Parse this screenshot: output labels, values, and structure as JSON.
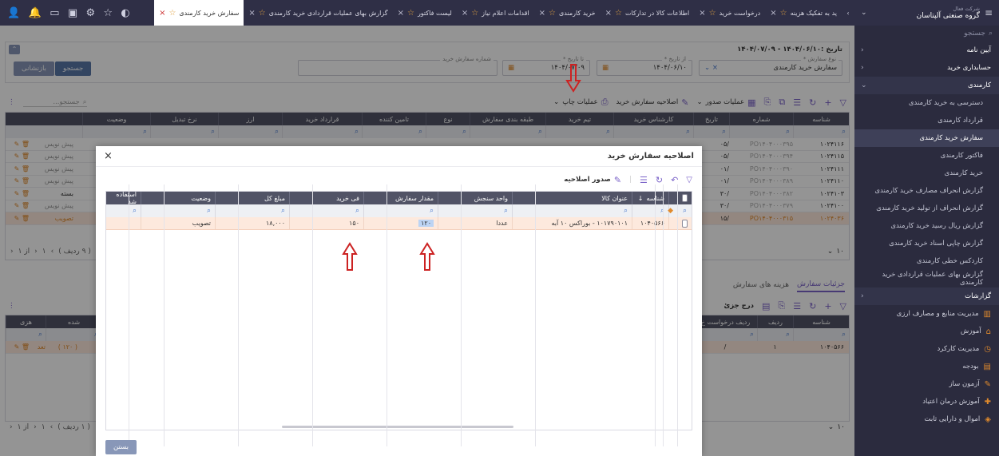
{
  "sidebar": {
    "company_sub": "شرکت فعال",
    "company": "گروه صنعتی آلپتاسان",
    "search_placeholder": "جستجو",
    "items": [
      {
        "label": "آیین نامه",
        "chev": "‹"
      },
      {
        "label": "حسابداری خرید",
        "chev": "‹"
      },
      {
        "label": "کارمندی",
        "chev": "⌄"
      }
    ],
    "subitems": [
      "دسترسی به خرید کارمندی",
      "قرارداد کارمندی",
      "سفارش خرید کارمندی",
      "فاکتور کارمندی",
      "خرید کارمندی",
      "گزارش انحراف مصارف خرید کارمندی",
      "گزارش انحراف از تولید خرید کارمندی",
      "گزارش ریال رسید خرید کارمندی",
      "گزارش چاپی اسناد خرید کارمندی",
      "کاردکس خطی کارمندی",
      "گزارش بهای عملیات قراردادی خرید کارمندی"
    ],
    "reports": "گزارشات",
    "modules": [
      "مدیریت منابع و مصارف ارزی",
      "آموزش",
      "مدیریت کارکرد",
      "بودجه",
      "آزمون ساز",
      "آموزش درمان اعتیاد",
      "اموال و دارایی ثابت"
    ]
  },
  "tabs": [
    "سفارش خرید کارمندی",
    "گزارش بهای عملیات قراردادی خرید کارمندی",
    "لیست فاکتور",
    "اقدامات اعلام نیاز",
    "خرید کارمندی",
    "اطلاعات کالا در تدارکات",
    "درخواست خرید",
    "ید به تفکیک هزینه"
  ],
  "filters": {
    "date_title": "تاریخ :۱۴۰۴/۰۶/۱۰ - ۱۴۰۴/۰۷/۰۹",
    "order_type_label": "نوع سفارش *",
    "order_type_value": "سفارش خرید کارمندی",
    "from_date_label": "از تاریخ *",
    "from_date_value": "۱۴۰۴/۰۶/۱۰",
    "to_date_label": "تا تاریخ *",
    "to_date_value": "۱۴۰۴/۰۷/۰۹",
    "order_no_label": "شماره سفارش خرید",
    "search_btn": "جستجو",
    "reset_btn": "بازنشانی"
  },
  "toolbar": {
    "issue_ops": "عملیات صدور",
    "amend_order": "اصلاحیه سفارش خرید",
    "print_ops": "عملیات چاپ",
    "search_placeholder": "جستجو..."
  },
  "grid": {
    "headers": [
      "شناسه",
      "شماره",
      "تاریخ",
      "کارشناس خرید",
      "تیم خرید",
      "طبقه بندی سفارش",
      "نوع",
      "تامین کننده",
      "قرارداد خرید",
      "ارز",
      "نرخ تبدیل",
      "وضعیت"
    ],
    "rows": [
      {
        "id": "۱۰۲۴۱۱۶",
        "num": "PO۱۴۰۴۰۰۰۳۹۵",
        "date": "/۰۵",
        "status": "پیش نویس"
      },
      {
        "id": "۱۰۲۴۱۱۵",
        "num": "PO۱۴۰۴۰۰۰۳۹۴",
        "date": "/۰۵",
        "status": "پیش نویس"
      },
      {
        "id": "۱۰۲۴۱۱۱",
        "num": "PO۱۴۰۴۰۰۰۳۹۰",
        "date": "/۰۱",
        "status": "پیش نویس"
      },
      {
        "id": "۱۰۲۴۱۱۰",
        "num": "PO۱۴۰۴۰۰۰۳۸۹",
        "date": "/۰۱",
        "status": "پیش نویس"
      },
      {
        "id": "۱۰۲۴۱۰۳",
        "num": "PO۱۴۰۴۰۰۰۳۸۲",
        "date": "/۳۰",
        "status": "بسته"
      },
      {
        "id": "۱۰۲۴۱۰۰",
        "num": "PO۱۴۰۴۰۰۰۳۷۹",
        "date": "/۳۰",
        "status": "پیش نویس"
      },
      {
        "id": "۱۰۲۴۰۳۶",
        "num": "PO۱۴۰۴۰۰۰۳۱۵",
        "date": "/۱۵",
        "status": "تصویب"
      }
    ],
    "pager": "( ۹ ردیف )",
    "page_of": "از ۱",
    "page_num": "۱",
    "page_size": "۱۰"
  },
  "detail": {
    "tabs": [
      "جزئیات سفارش",
      "هزینه های سفارش"
    ],
    "insert": "درج جزئ",
    "headers": [
      "شناسه",
      "ردیف",
      "ردیف درخواست خ"
    ],
    "left_headers": [
      "هزی",
      "شده"
    ],
    "row": {
      "id": "۱۰۴۰۵۶۶",
      "rownum": "۱",
      "slash": "/",
      "left": "تعد",
      "left2": "( ۱۲۰ )",
      "left3": "یر شده"
    },
    "pager": "( ۱ ردیف )",
    "page_of": "از ۱",
    "page_num": "۱",
    "page_size": "۱۰"
  },
  "modal": {
    "title": "اصلاحیه سفارش خرید",
    "close": "×",
    "issue": "صدور اصلاحیه",
    "headers": [
      "شناسه",
      "عنوان کالا",
      "واحد سنجش",
      "مقدار سفارش",
      "فی خرید",
      "مبلغ کل",
      "وضعیت",
      "استفاده شد"
    ],
    "row": {
      "id": "۱۰۴۰۵۶۶",
      "title": "۱۰۱۷۹۰۱۰۱ - بوراکس ۱۰ آبه",
      "unit": "عددا",
      "qty": "۱۲۰",
      "price": "۱۵۰",
      "total": "۱۸,۰۰۰",
      "status": "تصویب",
      "used": ""
    },
    "close_btn": "بستن"
  },
  "colors": {
    "accent": "#7a62c8",
    "highlight": "#fde9dd",
    "arrow": "#cc2222",
    "sidebar_bg": "#2b2b3e"
  }
}
